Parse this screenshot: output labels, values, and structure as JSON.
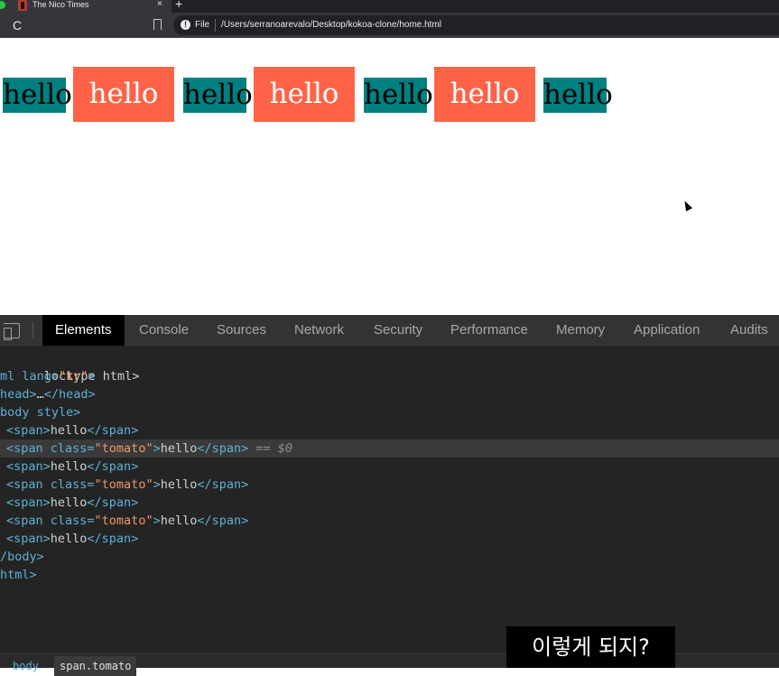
{
  "browser": {
    "tab_title": "The Nico Times",
    "tab_close": "×",
    "new_tab": "+",
    "reload_glyph": "C",
    "info_glyph": "!",
    "file_label": "File",
    "url": "/Users/serranoarevalo/Desktop/kokoa-clone/home.html"
  },
  "page": {
    "spans": [
      {
        "text": "hello",
        "class": "plain"
      },
      {
        "text": "hello",
        "class": "tomato"
      },
      {
        "text": "hello",
        "class": "plain"
      },
      {
        "text": "hello",
        "class": "tomato"
      },
      {
        "text": "hello",
        "class": "plain"
      },
      {
        "text": "hello",
        "class": "tomato"
      },
      {
        "text": "hello",
        "class": "plain"
      }
    ],
    "colors": {
      "plain_bg": "#008080",
      "tomato_bg": "#ff6347"
    }
  },
  "devtools": {
    "tabs": [
      "Elements",
      "Console",
      "Sources",
      "Network",
      "Security",
      "Performance",
      "Memory",
      "Application",
      "Audits"
    ],
    "active_tab": "Elements",
    "dom": {
      "doctype": "loctype html>",
      "html_open_tag": "ml lang=",
      "html_lang": "\"kr\"",
      "html_open_close": ">",
      "head": "head>",
      "head_ellipsis": "…",
      "head_close": "</head>",
      "body_open": "body style>",
      "span_open": "<span>",
      "span_class_open": "<span class=",
      "tomato_val": "\"tomato\"",
      "gt": ">",
      "hello": "hello",
      "span_close": "</span>",
      "selected_marker": " == $0",
      "body_close": "/body>",
      "html_close": "html>"
    },
    "breadcrumbs": [
      "body",
      "span.tomato"
    ]
  },
  "subtitle": "이렇게 되지?"
}
